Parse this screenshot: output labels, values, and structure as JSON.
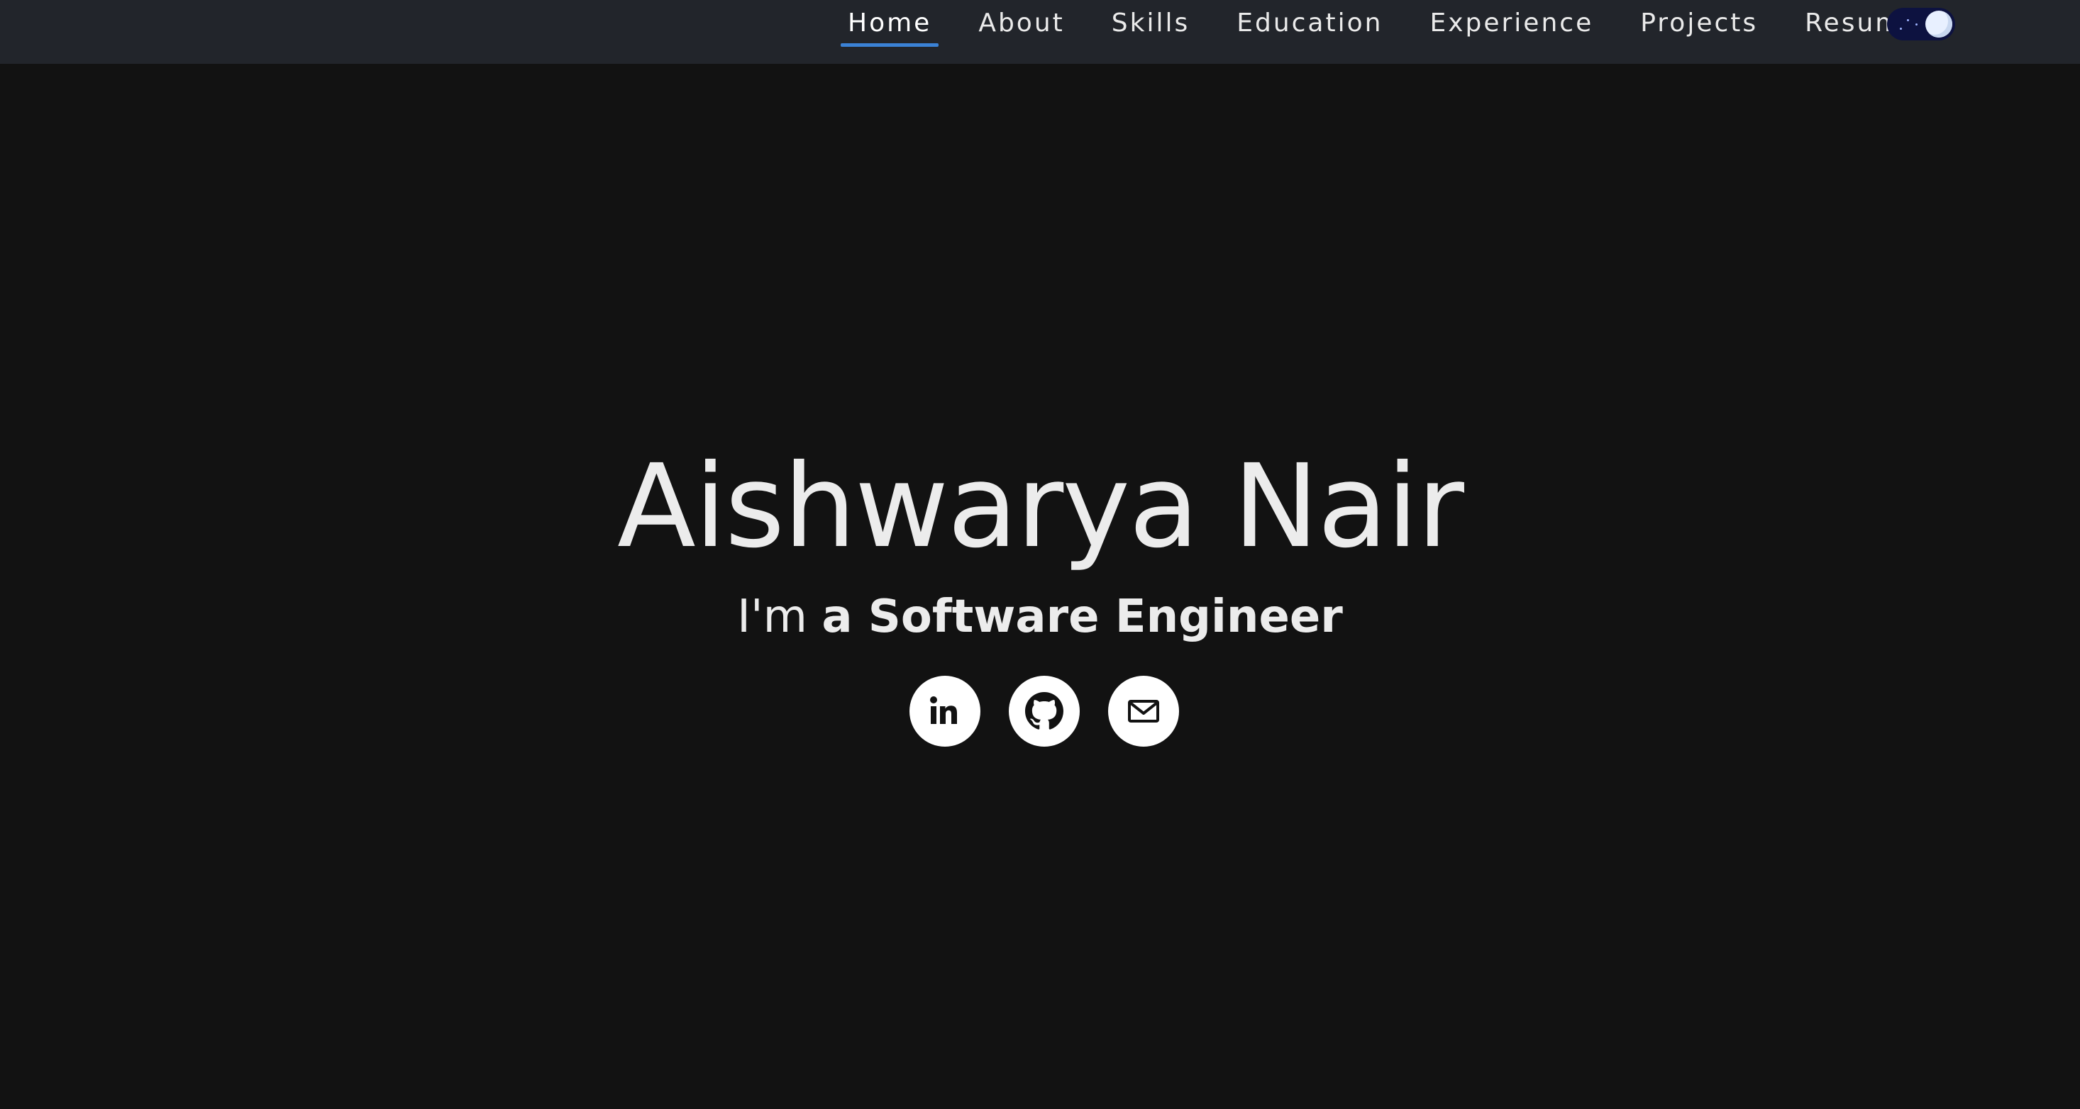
{
  "nav": {
    "items": [
      {
        "label": "Home",
        "active": true
      },
      {
        "label": "About",
        "active": false
      },
      {
        "label": "Skills",
        "active": false
      },
      {
        "label": "Education",
        "active": false
      },
      {
        "label": "Experience",
        "active": false
      },
      {
        "label": "Projects",
        "active": false
      },
      {
        "label": "Resume",
        "active": false
      }
    ],
    "theme_toggle": {
      "mode": "dark",
      "icon": "moon-icon"
    }
  },
  "hero": {
    "name": "Aishwarya Nair",
    "subtitle_prefix": "I'm ",
    "subtitle_role": "a Software Engineer"
  },
  "socials": [
    {
      "icon": "linkedin-icon"
    },
    {
      "icon": "github-icon"
    },
    {
      "icon": "mail-icon"
    }
  ],
  "colors": {
    "background": "#121212",
    "navbar": "#22252b",
    "accent": "#3b82d6",
    "text": "#ececec"
  }
}
